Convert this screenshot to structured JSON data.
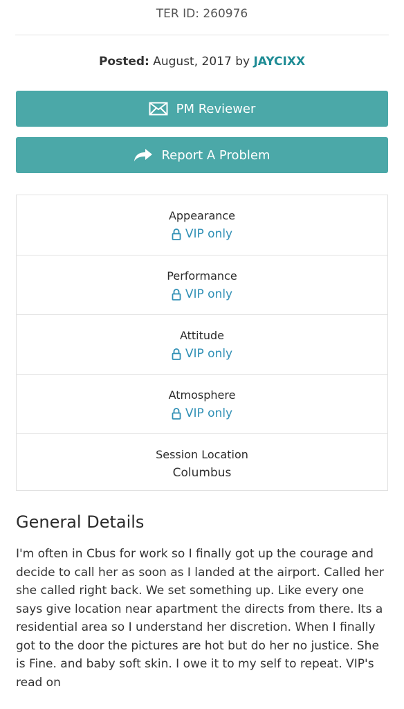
{
  "header": {
    "ter_id": "TER ID: 260976",
    "posted_label": "Posted:",
    "posted_date": "August, 2017",
    "posted_by": "by",
    "author": "JAYCIXX"
  },
  "buttons": {
    "pm_label": "PM Reviewer",
    "report_label": "Report A Problem"
  },
  "ratings": [
    {
      "label": "Appearance",
      "value": "VIP only",
      "locked": true
    },
    {
      "label": "Performance",
      "value": "VIP only",
      "locked": true
    },
    {
      "label": "Attitude",
      "value": "VIP only",
      "locked": true
    },
    {
      "label": "Atmosphere",
      "value": "VIP only",
      "locked": true
    },
    {
      "label": "Session Location",
      "value": "Columbus",
      "locked": false
    }
  ],
  "general": {
    "title": "General Details",
    "text": "I'm often in Cbus for work so I finally got up the courage and decide to call her as soon as I landed at the airport. Called her she called right back. We set something up. Like every one says give location near apartment the directs from there. Its a residential area so I understand her discretion. When I finally got to the door the pictures are hot but do her no justice. She is Fine. and baby soft skin. I owe it to my self to repeat. VIP's read on"
  },
  "colors": {
    "button_bg": "#4ba8a8",
    "link": "#2f8fb5",
    "author": "#1f8c95"
  },
  "icons": {
    "pm": "envelope-icon",
    "report": "share-arrow-icon",
    "locked": "lock-icon"
  }
}
